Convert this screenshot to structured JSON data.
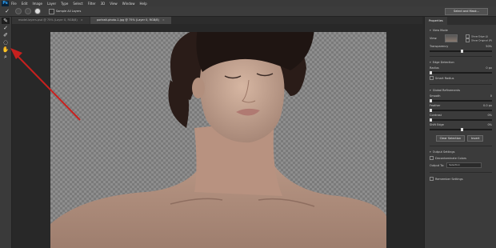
{
  "menubar": {
    "logo": "Ps",
    "items": [
      "File",
      "Edit",
      "Image",
      "Layer",
      "Type",
      "Select",
      "Filter",
      "3D",
      "View",
      "Window",
      "Help"
    ]
  },
  "options": {
    "tool_icon": "brush-icon",
    "sample_all_layers": "Sample All Layers",
    "select_and_mask": "Select and Mask..."
  },
  "tabs": [
    {
      "label": "model-layers.psd @ 75% (Layer 0, RGB/8)"
    },
    {
      "label": "portrait-photo-1.jpg @ 75% (Layer 0, RGB/8)"
    }
  ],
  "panel": {
    "title": "Properties",
    "view_mode": "View Mode",
    "view": "View:",
    "show_edge": "Show Edge (J)",
    "show_original": "Show Original (P)",
    "transparency": "Transparency",
    "transparency_value": "50%",
    "transparency_level": 0.5,
    "edge_detection": "Edge Detection",
    "radius": "Radius",
    "radius_value": "0 px",
    "radius_level": 0.0,
    "smart_radius": "Smart Radius",
    "global_refinements": "Global Refinements",
    "smooth": "Smooth",
    "smooth_value": "0",
    "smooth_level": 0.0,
    "feather": "Feather",
    "feather_value": "0.0 px",
    "feather_level": 0.0,
    "contrast": "Contrast",
    "contrast_value": "0%",
    "contrast_level": 0.0,
    "shift_edge": "Shift Edge",
    "shift_edge_value": "0%",
    "shift_edge_level": 0.5,
    "clear_selection": "Clear Selection",
    "invert": "Invert",
    "output_settings": "Output Settings",
    "decontaminate": "Decontaminate Colors",
    "output_to": "Output To:",
    "output_to_value": "Selection",
    "remember": "Remember Settings"
  },
  "colors": {
    "accent_arrow": "#c8201e",
    "checker_dark": "#7a7a7a",
    "checker_light": "#8e8e8e"
  }
}
